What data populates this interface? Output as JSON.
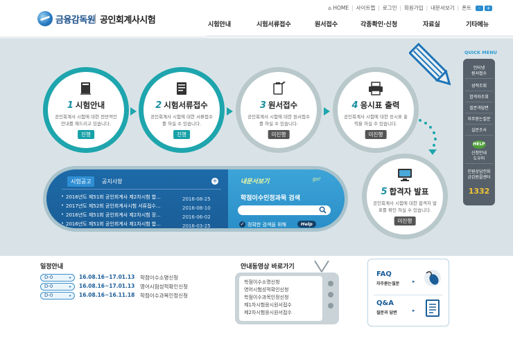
{
  "header": {
    "org_name": "금융감독원",
    "site_name": "공인회계사시험",
    "util": [
      "HOME",
      "사이트맵",
      "로그인",
      "회원가입",
      "내문서보기",
      "폰트"
    ],
    "font_minus": "-",
    "font_plus": "+",
    "gnb": [
      "시험안내",
      "시험서류접수",
      "원서접수",
      "각종확인·신청",
      "자료실",
      "기타메뉴"
    ]
  },
  "steps": [
    {
      "num": "1",
      "title": "시험안내",
      "desc": "공인회계사 시험에 대한 전반적인 안내를 해드리고 있습니다.",
      "status": "진행",
      "active": true,
      "icon": "book-icon"
    },
    {
      "num": "2",
      "title": "시험서류접수",
      "desc": "공인회계사 시험에 대한 서류접수를 하실 수 있습니다.",
      "status": "진행",
      "active": true,
      "icon": "document-icon"
    },
    {
      "num": "3",
      "title": "원서접수",
      "desc": "공인회계사 시험에 대한 원서접수를 하실 수 있습니다.",
      "status": "미진행",
      "active": false,
      "icon": "clipboard-icon"
    },
    {
      "num": "4",
      "title": "응시표 출력",
      "desc": "공인회계사 시험에 대한 응시표 출력을 하실 수 있습니다.",
      "status": "미진행",
      "active": false,
      "icon": "printer-icon"
    },
    {
      "num": "5",
      "title": "합격자 발표",
      "desc": "공인회계사 시험에 대한 합격자 발표를 확인 하실 수 있습니다.",
      "status": "미진행",
      "active": false,
      "icon": "monitor-icon"
    }
  ],
  "notice": {
    "tabs": [
      "시험공고",
      "공지사항"
    ],
    "plus": "+",
    "items": [
      {
        "title": "2016년도 제51회 공인회계사 제2차시험 합...",
        "date": "2016-08-25"
      },
      {
        "title": "2017년도 제52회 공인회계사시험 서류접수...",
        "date": "2016-08-10"
      },
      {
        "title": "2016년도 제51회 공인회계사 제2차시험 장...",
        "date": "2016-06-02"
      },
      {
        "title": "2016년도 제51회 공인회계사 제1차시험 합...",
        "date": "2016-03-25"
      }
    ]
  },
  "tool": {
    "logo": "내문서보기",
    "go": "go!",
    "search_title": "학점이수인정과목 검색",
    "search_placeholder": "",
    "help_text": "정확한 검색을 위해",
    "help_button": "Help"
  },
  "quick_menu": {
    "title": "QUICK MENU",
    "items": [
      "인터넷\n원서접수",
      "성적조회",
      "합격자조회",
      "질문과답변",
      "자주묻는질문",
      "실문조사"
    ],
    "help_badge": "HELP",
    "help_label": "신청안내\n도우미",
    "phone_label": "민원상담전화\n금감원콜센터",
    "phone": "1332"
  },
  "schedule": {
    "title": "일정안내",
    "items": [
      {
        "dday": "D-0",
        "date": "16.08.16~17.01.13",
        "name": "학점이수소명신청"
      },
      {
        "dday": "D-0",
        "date": "16.08.16~17.01.13",
        "name": "영어시험성적확인신청"
      },
      {
        "dday": "D-0",
        "date": "16.08.16~16.11.18",
        "name": "학점이수과목인정신청"
      }
    ]
  },
  "video": {
    "title": "안내동영상 바로가기",
    "items": [
      "학점이수소명신청",
      "영어시험성적확인신청",
      "학점이수과목인정신청",
      "제1차시험응시원서접수",
      "제2차시험응시원서접수"
    ]
  },
  "faq": {
    "title": "FAQ",
    "sub": "자주묻는질문",
    "qa_title": "Q&A",
    "qa_sub": "질문과 답변",
    "arrow": "▸"
  },
  "colors": {
    "accent_teal": "#1ea5ad",
    "accent_blue": "#1b5e98",
    "main_bg": "#d9e3e7"
  }
}
